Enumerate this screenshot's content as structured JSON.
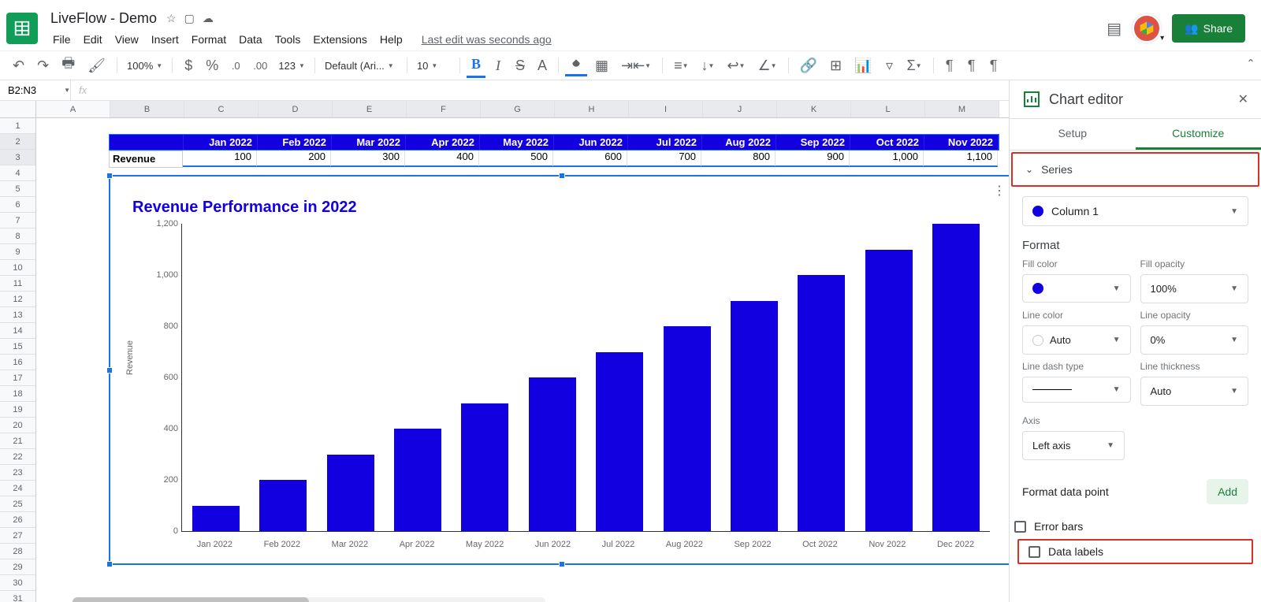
{
  "titlebar": {
    "doc_title": "LiveFlow - Demo",
    "menus": [
      "File",
      "Edit",
      "View",
      "Insert",
      "Format",
      "Data",
      "Tools",
      "Extensions",
      "Help"
    ],
    "last_edit": "Last edit was seconds ago",
    "share_label": "Share"
  },
  "toolbar": {
    "zoom": "100%",
    "font": "Default (Ari...",
    "font_size": "10"
  },
  "formula_bar": {
    "range": "B2:N3"
  },
  "grid": {
    "columns": [
      "A",
      "B",
      "C",
      "D",
      "E",
      "F",
      "G",
      "H",
      "I",
      "J",
      "K",
      "L",
      "M"
    ],
    "row_count": 31,
    "data_headers": [
      "Jan 2022",
      "Feb 2022",
      "Mar 2022",
      "Apr 2022",
      "May 2022",
      "Jun 2022",
      "Jul 2022",
      "Aug 2022",
      "Sep 2022",
      "Oct 2022",
      "Nov 2022"
    ],
    "data_label": "Revenue",
    "data_values": [
      "100",
      "200",
      "300",
      "400",
      "500",
      "600",
      "700",
      "800",
      "900",
      "1,000",
      "1,100"
    ]
  },
  "chart_data": {
    "type": "bar",
    "title": "Revenue Performance in 2022",
    "ylabel": "Revenue",
    "xlabel": "",
    "categories": [
      "Jan 2022",
      "Feb 2022",
      "Mar 2022",
      "Apr 2022",
      "May 2022",
      "Jun 2022",
      "Jul 2022",
      "Aug 2022",
      "Sep 2022",
      "Oct 2022",
      "Nov 2022",
      "Dec 2022"
    ],
    "values": [
      100,
      200,
      300,
      400,
      500,
      600,
      700,
      800,
      900,
      1000,
      1100,
      1200
    ],
    "ylim": [
      0,
      1200
    ],
    "y_ticks": [
      0,
      200,
      400,
      600,
      800,
      1000,
      1200
    ],
    "y_tick_labels": [
      "0",
      "200",
      "400",
      "600",
      "800",
      "1,000",
      "1,200"
    ]
  },
  "sidebar": {
    "title": "Chart editor",
    "tabs": {
      "setup": "Setup",
      "customize": "Customize"
    },
    "section": "Series",
    "series_selected": "Column 1",
    "format_label": "Format",
    "fields": {
      "fill_color": {
        "label": "Fill color"
      },
      "fill_opacity": {
        "label": "Fill opacity",
        "value": "100%"
      },
      "line_color": {
        "label": "Line color",
        "value": "Auto"
      },
      "line_opacity": {
        "label": "Line opacity",
        "value": "0%"
      },
      "line_dash": {
        "label": "Line dash type"
      },
      "line_thickness": {
        "label": "Line thickness",
        "value": "Auto"
      },
      "axis": {
        "label": "Axis",
        "value": "Left axis"
      }
    },
    "format_data_point": "Format data point",
    "add_label": "Add",
    "error_bars": "Error bars",
    "data_labels": "Data labels"
  }
}
